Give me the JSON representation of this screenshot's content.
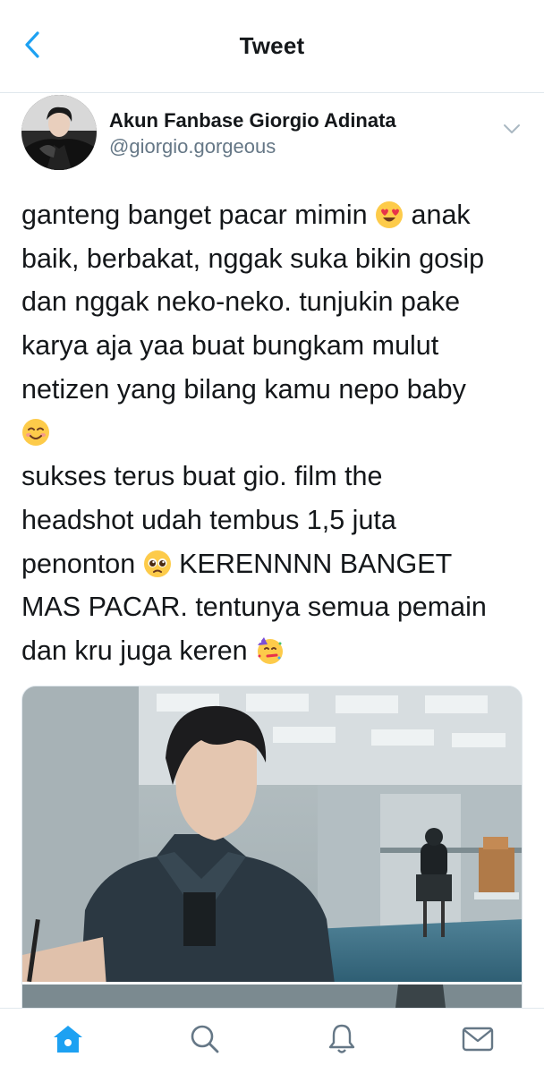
{
  "nav": {
    "title": "Tweet",
    "back_icon": "chevron-left-icon"
  },
  "author": {
    "display_name": "Akun Fanbase Giorgio Adinata",
    "handle": "@giorgio.gorgeous"
  },
  "tweet": {
    "lines": [
      "ganteng banget pacar mimin ",
      " anak",
      "baik, berbakat, nggak suka bikin gosip",
      "dan nggak neko-neko. tunjukin pake",
      "karya aja yaa buat bungkam mulut",
      "netizen yang bilang kamu nepo baby",
      "sukses terus buat gio. film the",
      "headshot udah tembus 1,5 juta",
      "penonton ",
      " KERENNNN BANGET",
      "MAS PACAR. tentunya semua pemain",
      "dan kru juga keren "
    ],
    "emojis": [
      "heart-eyes-emoji",
      "smiling-face-emoji",
      "pleading-face-emoji",
      "partying-face-emoji"
    ]
  },
  "tabs": [
    "home-icon",
    "search-icon",
    "notifications-icon",
    "messages-icon"
  ],
  "colors": {
    "accent": "#1da1f2",
    "secondary_text": "#657786",
    "divider": "#e1e8ed"
  }
}
